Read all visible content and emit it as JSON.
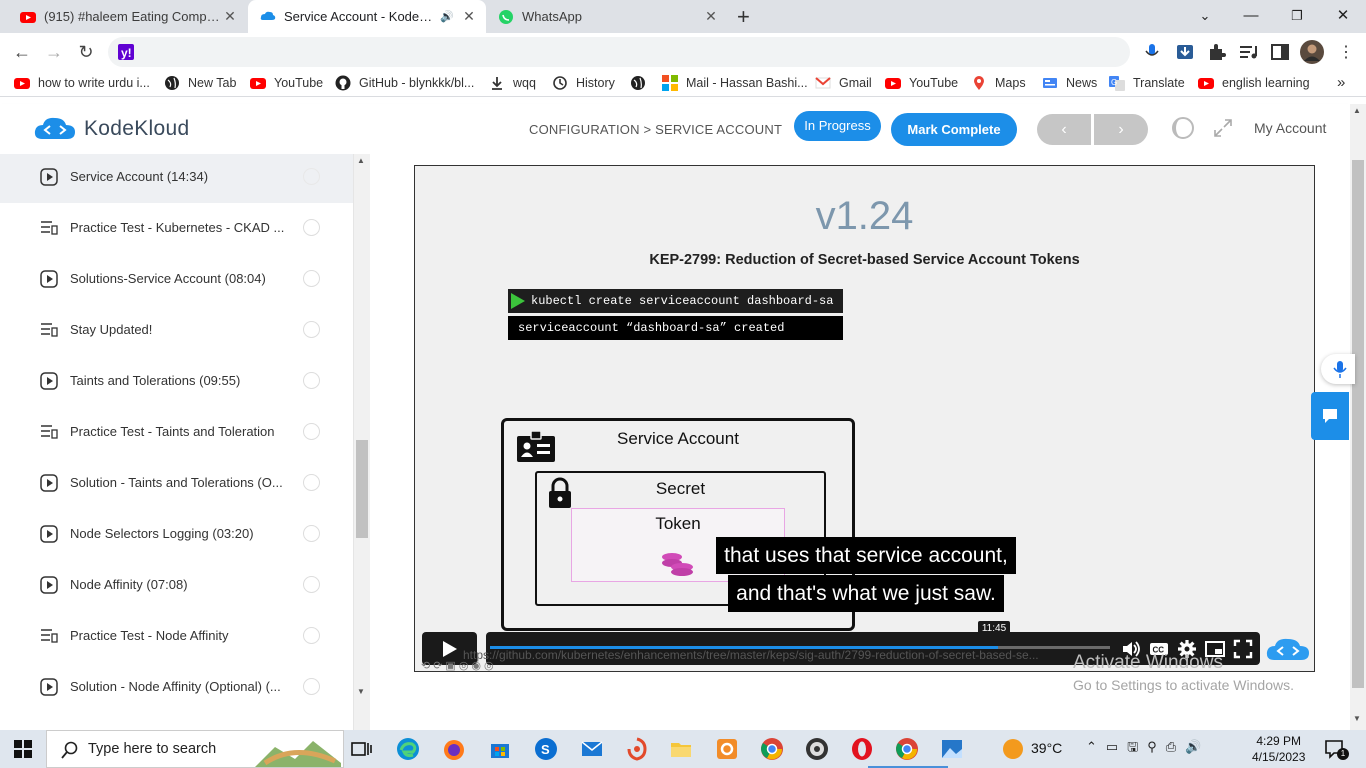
{
  "browser": {
    "tabs": [
      {
        "title": "(915) #haleem Eating Competitio",
        "icon": "youtube-icon",
        "active": false
      },
      {
        "title": "Service Account - KodeKloud",
        "icon": "kodekloud-icon",
        "active": true
      },
      {
        "title": "WhatsApp",
        "icon": "whatsapp-icon",
        "active": false
      }
    ],
    "new_tab_label": "+",
    "bookmarks": [
      {
        "label": "how to write urdu i...",
        "icon": "youtube-icon"
      },
      {
        "label": "New Tab",
        "icon": "globe-icon"
      },
      {
        "label": "YouTube",
        "icon": "youtube-icon"
      },
      {
        "label": "GitHub - blynkkk/bl...",
        "icon": "github-icon"
      },
      {
        "label": "wqq",
        "icon": "download-icon"
      },
      {
        "label": "History",
        "icon": "history-icon"
      },
      {
        "label": "",
        "icon": "globe-icon"
      },
      {
        "label": "Mail - Hassan Bashi...",
        "icon": "microsoft-icon"
      },
      {
        "label": "Gmail",
        "icon": "gmail-icon"
      },
      {
        "label": "YouTube",
        "icon": "youtube-icon"
      },
      {
        "label": "Maps",
        "icon": "maps-icon"
      },
      {
        "label": "News",
        "icon": "news-icon"
      },
      {
        "label": "Translate",
        "icon": "translate-icon"
      },
      {
        "label": "english learning",
        "icon": "youtube-icon"
      }
    ],
    "more_bookmarks": "»"
  },
  "header": {
    "brand": "KodeKloud",
    "breadcrumb": "CONFIGURATION > SERVICE ACCOUNT",
    "status_pill": "In Progress",
    "mark_complete": "Mark Complete",
    "prev": "‹",
    "next": "›",
    "account": "My Account"
  },
  "sidebar": {
    "items": [
      {
        "label": "Service Account (14:34)",
        "type": "video",
        "active": true
      },
      {
        "label": "Practice Test - Kubernetes - CKAD ...",
        "type": "lab",
        "active": false
      },
      {
        "label": "Solutions-Service Account (08:04)",
        "type": "video",
        "active": false
      },
      {
        "label": "Stay Updated!",
        "type": "lab",
        "active": false
      },
      {
        "label": "Taints and Tolerations (09:55)",
        "type": "video",
        "active": false
      },
      {
        "label": "Practice Test - Taints and Toleration",
        "type": "lab",
        "active": false
      },
      {
        "label": "Solution - Taints and Tolerations (O...",
        "type": "video",
        "active": false
      },
      {
        "label": "Node Selectors Logging (03:20)",
        "type": "video",
        "active": false
      },
      {
        "label": "Node Affinity (07:08)",
        "type": "video",
        "active": false
      },
      {
        "label": "Practice Test - Node Affinity",
        "type": "lab",
        "active": false
      },
      {
        "label": "Solution - Node Affinity (Optional) (...",
        "type": "video",
        "active": false
      }
    ]
  },
  "video": {
    "version": "v1.24",
    "heading": "KEP-2799: Reduction of Secret-based Service Account Tokens",
    "terminal_cmd": "kubectl create serviceaccount dashboard-sa",
    "terminal_out": "serviceaccount “dashboard-sa” created",
    "sa_label": "Service Account",
    "secret_label": "Secret",
    "token_label": "Token",
    "caption_line1": "that uses that service account,",
    "caption_line2": "and that's what we just saw.",
    "time_tooltip": "11:45",
    "progress": 0.82,
    "hover_url": "https://github.com/kubernetes/enhancements/tree/master/keps/sig-auth/2799-reduction-of-secret-based-se..."
  },
  "watermark": {
    "line1": "Activate Windows",
    "line2": "Go to Settings to activate Windows."
  },
  "taskbar": {
    "search_placeholder": "Type here to search",
    "weather": "39°C",
    "time": "4:29 PM",
    "date": "4/15/2023",
    "notif_count": "1"
  }
}
